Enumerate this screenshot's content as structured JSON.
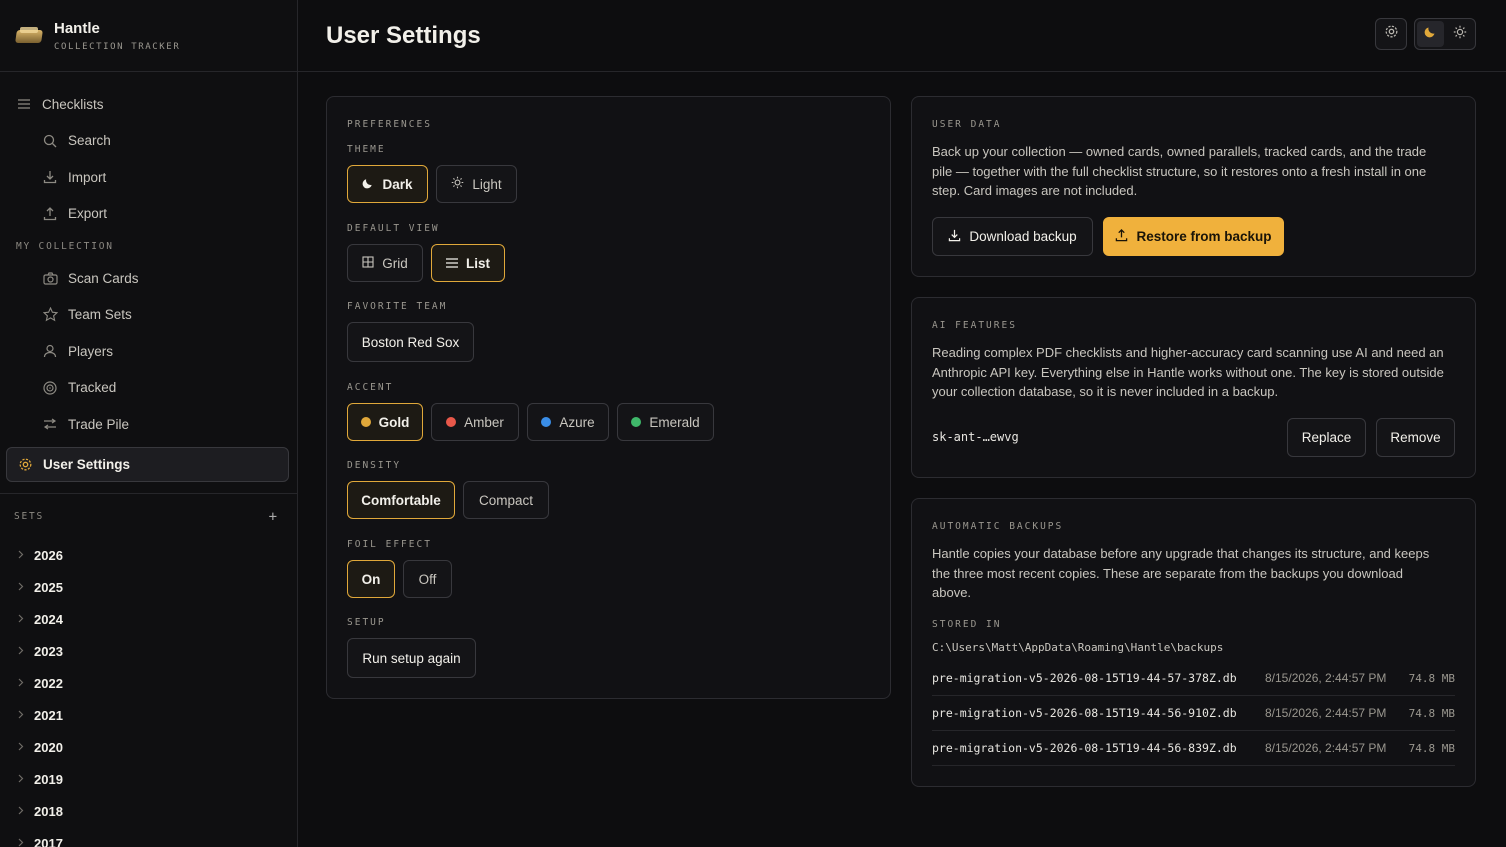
{
  "brand": {
    "title": "Hantle",
    "subtitle": "COLLECTION TRACKER"
  },
  "nav": {
    "checklists": "Checklists",
    "search": "Search",
    "import": "Import",
    "export": "Export",
    "my_collection": "MY COLLECTION",
    "scan_cards": "Scan Cards",
    "team_sets": "Team Sets",
    "players": "Players",
    "tracked": "Tracked",
    "trade_pile": "Trade Pile",
    "user_settings": "User Settings"
  },
  "sets": {
    "label": "SETS",
    "add": "+",
    "years": [
      "2026",
      "2025",
      "2024",
      "2023",
      "2022",
      "2021",
      "2020",
      "2019",
      "2018",
      "2017"
    ]
  },
  "header": {
    "title": "User Settings"
  },
  "preferences": {
    "label": "PREFERENCES",
    "theme": {
      "label": "THEME",
      "dark": "Dark",
      "light": "Light"
    },
    "default_view": {
      "label": "DEFAULT VIEW",
      "grid": "Grid",
      "list": "List"
    },
    "favorite_team": {
      "label": "FAVORITE TEAM",
      "value": "Boston Red Sox"
    },
    "accent": {
      "label": "ACCENT",
      "options": [
        {
          "name": "Gold",
          "color": "#e0a83a"
        },
        {
          "name": "Amber",
          "color": "#e8584a"
        },
        {
          "name": "Azure",
          "color": "#3a8ee8"
        },
        {
          "name": "Emerald",
          "color": "#3fb86a"
        }
      ]
    },
    "density": {
      "label": "DENSITY",
      "comfortable": "Comfortable",
      "compact": "Compact"
    },
    "foil": {
      "label": "FOIL EFFECT",
      "on": "On",
      "off": "Off"
    },
    "setup": {
      "label": "SETUP",
      "button": "Run setup again"
    }
  },
  "user_data": {
    "label": "USER DATA",
    "line1": "Back up your collection — owned cards, owned parallels, tracked cards, and the trade",
    "line2": "pile — together with the full checklist structure, so it restores onto a fresh install in one",
    "line3": "step. Card images are not included.",
    "download": "Download backup",
    "restore": "Restore from backup"
  },
  "ai": {
    "label": "AI FEATURES",
    "line1": "Reading complex PDF checklists and higher-accuracy card scanning use AI and need an",
    "line2": "Anthropic API key. Everything else in Hantle works without one. The key is stored outside",
    "line3": "your collection database, so it is never included in a backup.",
    "key": "sk-ant-…ewvg",
    "replace": "Replace",
    "remove": "Remove"
  },
  "auto": {
    "label": "AUTOMATIC BACKUPS",
    "line1": "Hantle copies your database before any upgrade that changes its structure, and keeps",
    "line2": "the three most recent copies. These are separate from the backups you download",
    "line3": "above.",
    "stored_label": "STORED IN",
    "path": "C:\\Users\\Matt\\AppData\\Roaming\\Hantle\\backups",
    "files": [
      {
        "name": "pre-migration-v5-2026-08-15T19-44-57-378Z.db",
        "date": "8/15/2026, 2:44:57 PM",
        "size": "74.8 MB"
      },
      {
        "name": "pre-migration-v5-2026-08-15T19-44-56-910Z.db",
        "date": "8/15/2026, 2:44:57 PM",
        "size": "74.8 MB"
      },
      {
        "name": "pre-migration-v5-2026-08-15T19-44-56-839Z.db",
        "date": "8/15/2026, 2:44:57 PM",
        "size": "74.8 MB"
      }
    ]
  }
}
